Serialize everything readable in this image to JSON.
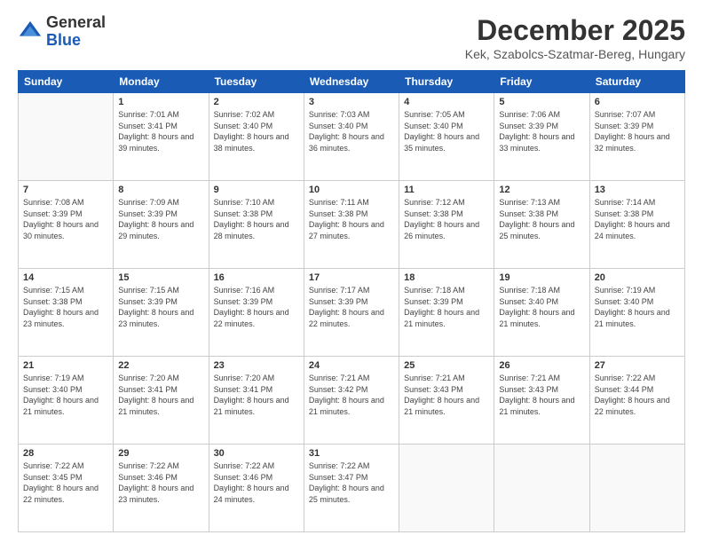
{
  "header": {
    "logo_line1": "General",
    "logo_line2": "Blue",
    "title": "December 2025",
    "subtitle": "Kek, Szabolcs-Szatmar-Bereg, Hungary"
  },
  "days_of_week": [
    "Sunday",
    "Monday",
    "Tuesday",
    "Wednesday",
    "Thursday",
    "Friday",
    "Saturday"
  ],
  "weeks": [
    [
      {
        "day": "",
        "sunrise": "",
        "sunset": "",
        "daylight": ""
      },
      {
        "day": "1",
        "sunrise": "Sunrise: 7:01 AM",
        "sunset": "Sunset: 3:41 PM",
        "daylight": "Daylight: 8 hours and 39 minutes."
      },
      {
        "day": "2",
        "sunrise": "Sunrise: 7:02 AM",
        "sunset": "Sunset: 3:40 PM",
        "daylight": "Daylight: 8 hours and 38 minutes."
      },
      {
        "day": "3",
        "sunrise": "Sunrise: 7:03 AM",
        "sunset": "Sunset: 3:40 PM",
        "daylight": "Daylight: 8 hours and 36 minutes."
      },
      {
        "day": "4",
        "sunrise": "Sunrise: 7:05 AM",
        "sunset": "Sunset: 3:40 PM",
        "daylight": "Daylight: 8 hours and 35 minutes."
      },
      {
        "day": "5",
        "sunrise": "Sunrise: 7:06 AM",
        "sunset": "Sunset: 3:39 PM",
        "daylight": "Daylight: 8 hours and 33 minutes."
      },
      {
        "day": "6",
        "sunrise": "Sunrise: 7:07 AM",
        "sunset": "Sunset: 3:39 PM",
        "daylight": "Daylight: 8 hours and 32 minutes."
      }
    ],
    [
      {
        "day": "7",
        "sunrise": "Sunrise: 7:08 AM",
        "sunset": "Sunset: 3:39 PM",
        "daylight": "Daylight: 8 hours and 30 minutes."
      },
      {
        "day": "8",
        "sunrise": "Sunrise: 7:09 AM",
        "sunset": "Sunset: 3:39 PM",
        "daylight": "Daylight: 8 hours and 29 minutes."
      },
      {
        "day": "9",
        "sunrise": "Sunrise: 7:10 AM",
        "sunset": "Sunset: 3:38 PM",
        "daylight": "Daylight: 8 hours and 28 minutes."
      },
      {
        "day": "10",
        "sunrise": "Sunrise: 7:11 AM",
        "sunset": "Sunset: 3:38 PM",
        "daylight": "Daylight: 8 hours and 27 minutes."
      },
      {
        "day": "11",
        "sunrise": "Sunrise: 7:12 AM",
        "sunset": "Sunset: 3:38 PM",
        "daylight": "Daylight: 8 hours and 26 minutes."
      },
      {
        "day": "12",
        "sunrise": "Sunrise: 7:13 AM",
        "sunset": "Sunset: 3:38 PM",
        "daylight": "Daylight: 8 hours and 25 minutes."
      },
      {
        "day": "13",
        "sunrise": "Sunrise: 7:14 AM",
        "sunset": "Sunset: 3:38 PM",
        "daylight": "Daylight: 8 hours and 24 minutes."
      }
    ],
    [
      {
        "day": "14",
        "sunrise": "Sunrise: 7:15 AM",
        "sunset": "Sunset: 3:38 PM",
        "daylight": "Daylight: 8 hours and 23 minutes."
      },
      {
        "day": "15",
        "sunrise": "Sunrise: 7:15 AM",
        "sunset": "Sunset: 3:39 PM",
        "daylight": "Daylight: 8 hours and 23 minutes."
      },
      {
        "day": "16",
        "sunrise": "Sunrise: 7:16 AM",
        "sunset": "Sunset: 3:39 PM",
        "daylight": "Daylight: 8 hours and 22 minutes."
      },
      {
        "day": "17",
        "sunrise": "Sunrise: 7:17 AM",
        "sunset": "Sunset: 3:39 PM",
        "daylight": "Daylight: 8 hours and 22 minutes."
      },
      {
        "day": "18",
        "sunrise": "Sunrise: 7:18 AM",
        "sunset": "Sunset: 3:39 PM",
        "daylight": "Daylight: 8 hours and 21 minutes."
      },
      {
        "day": "19",
        "sunrise": "Sunrise: 7:18 AM",
        "sunset": "Sunset: 3:40 PM",
        "daylight": "Daylight: 8 hours and 21 minutes."
      },
      {
        "day": "20",
        "sunrise": "Sunrise: 7:19 AM",
        "sunset": "Sunset: 3:40 PM",
        "daylight": "Daylight: 8 hours and 21 minutes."
      }
    ],
    [
      {
        "day": "21",
        "sunrise": "Sunrise: 7:19 AM",
        "sunset": "Sunset: 3:40 PM",
        "daylight": "Daylight: 8 hours and 21 minutes."
      },
      {
        "day": "22",
        "sunrise": "Sunrise: 7:20 AM",
        "sunset": "Sunset: 3:41 PM",
        "daylight": "Daylight: 8 hours and 21 minutes."
      },
      {
        "day": "23",
        "sunrise": "Sunrise: 7:20 AM",
        "sunset": "Sunset: 3:41 PM",
        "daylight": "Daylight: 8 hours and 21 minutes."
      },
      {
        "day": "24",
        "sunrise": "Sunrise: 7:21 AM",
        "sunset": "Sunset: 3:42 PM",
        "daylight": "Daylight: 8 hours and 21 minutes."
      },
      {
        "day": "25",
        "sunrise": "Sunrise: 7:21 AM",
        "sunset": "Sunset: 3:43 PM",
        "daylight": "Daylight: 8 hours and 21 minutes."
      },
      {
        "day": "26",
        "sunrise": "Sunrise: 7:21 AM",
        "sunset": "Sunset: 3:43 PM",
        "daylight": "Daylight: 8 hours and 21 minutes."
      },
      {
        "day": "27",
        "sunrise": "Sunrise: 7:22 AM",
        "sunset": "Sunset: 3:44 PM",
        "daylight": "Daylight: 8 hours and 22 minutes."
      }
    ],
    [
      {
        "day": "28",
        "sunrise": "Sunrise: 7:22 AM",
        "sunset": "Sunset: 3:45 PM",
        "daylight": "Daylight: 8 hours and 22 minutes."
      },
      {
        "day": "29",
        "sunrise": "Sunrise: 7:22 AM",
        "sunset": "Sunset: 3:46 PM",
        "daylight": "Daylight: 8 hours and 23 minutes."
      },
      {
        "day": "30",
        "sunrise": "Sunrise: 7:22 AM",
        "sunset": "Sunset: 3:46 PM",
        "daylight": "Daylight: 8 hours and 24 minutes."
      },
      {
        "day": "31",
        "sunrise": "Sunrise: 7:22 AM",
        "sunset": "Sunset: 3:47 PM",
        "daylight": "Daylight: 8 hours and 25 minutes."
      },
      {
        "day": "",
        "sunrise": "",
        "sunset": "",
        "daylight": ""
      },
      {
        "day": "",
        "sunrise": "",
        "sunset": "",
        "daylight": ""
      },
      {
        "day": "",
        "sunrise": "",
        "sunset": "",
        "daylight": ""
      }
    ]
  ]
}
